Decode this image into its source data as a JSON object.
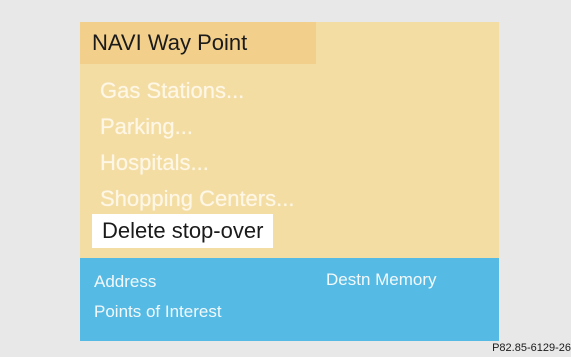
{
  "header": {
    "title": "NAVI Way Point"
  },
  "menu": {
    "items": [
      {
        "label": "Gas Stations..."
      },
      {
        "label": "Parking..."
      },
      {
        "label": "Hospitals..."
      },
      {
        "label": "Shopping Centers..."
      },
      {
        "label": "Delete stop-over",
        "selected": true
      }
    ]
  },
  "softkeys": {
    "address": "Address",
    "destn_memory": "Destn Memory",
    "points_of_interest": "Points of Interest"
  },
  "caption": "P82.85-6129-26",
  "colors": {
    "screen_bg": "#f3dda3",
    "title_bg": "#f2cf8a",
    "softkey_bar": "#55bbe4",
    "selection": "#ffffff"
  }
}
